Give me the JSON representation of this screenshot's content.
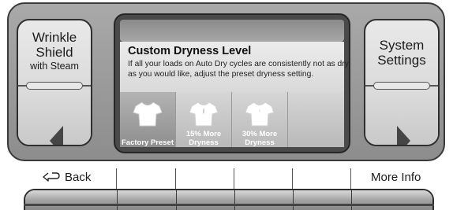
{
  "left_button": {
    "line1": "Wrinkle",
    "line2": "Shield",
    "line3": "with Steam"
  },
  "right_button": {
    "line1": "System",
    "line2": "Settings"
  },
  "screen": {
    "title": "Custom Dryness Level",
    "description": "If all your loads on Auto Dry cycles are consistently not as dry as you would like, adjust the preset dryness setting.",
    "options": [
      {
        "line1": "Factory Preset",
        "line2": "",
        "selected": true
      },
      {
        "line1": "15% More",
        "line2": "Dryness",
        "selected": false
      },
      {
        "line1": "30% More",
        "line2": "Dryness",
        "selected": false
      }
    ]
  },
  "softkeys": {
    "back_label": "Back",
    "more_info_label": "More Info"
  },
  "icons": {
    "left_arrow": "triangle-left-icon",
    "right_arrow": "triangle-right-icon",
    "back": "return-arrow-icon",
    "shirt": "shirt-icon"
  },
  "colors": {
    "panel": "#9a9a9a",
    "screen": "#4a4a4a",
    "text": "#111111"
  }
}
